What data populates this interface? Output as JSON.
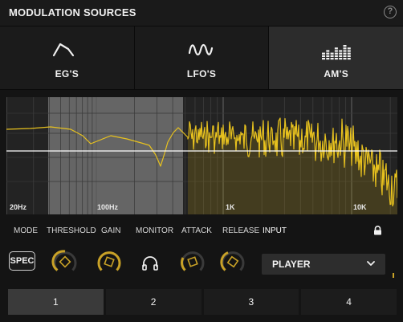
{
  "header": {
    "title": "MODULATION SOURCES",
    "help": "?"
  },
  "tabs": [
    {
      "label": "EG'S",
      "icon": "envelope-icon",
      "active": false
    },
    {
      "label": "LFO'S",
      "icon": "lfo-wave-icon",
      "active": false
    },
    {
      "label": "AM'S",
      "icon": "meter-bars-icon",
      "active": true
    }
  ],
  "spectrum": {
    "freq_labels": [
      "20Hz",
      "100Hz",
      "1K",
      "10K"
    ],
    "colors": {
      "trace": "#e8c21e",
      "fill": "#b49414",
      "selection": "#7c7c7c",
      "background": "#232323"
    }
  },
  "controls": {
    "labels": {
      "mode": "MODE",
      "threshold": "THRESHOLD",
      "gain": "GAIN",
      "monitor": "MONITOR",
      "attack": "ATTACK",
      "release": "RELEASE",
      "input": "INPUT"
    },
    "mode_button": "SPEC",
    "input_value": "PLAYER",
    "accent": "#c9a227"
  },
  "slots": [
    {
      "label": "1",
      "active": true
    },
    {
      "label": "2",
      "active": false
    },
    {
      "label": "3",
      "active": false
    },
    {
      "label": "4",
      "active": false
    }
  ]
}
